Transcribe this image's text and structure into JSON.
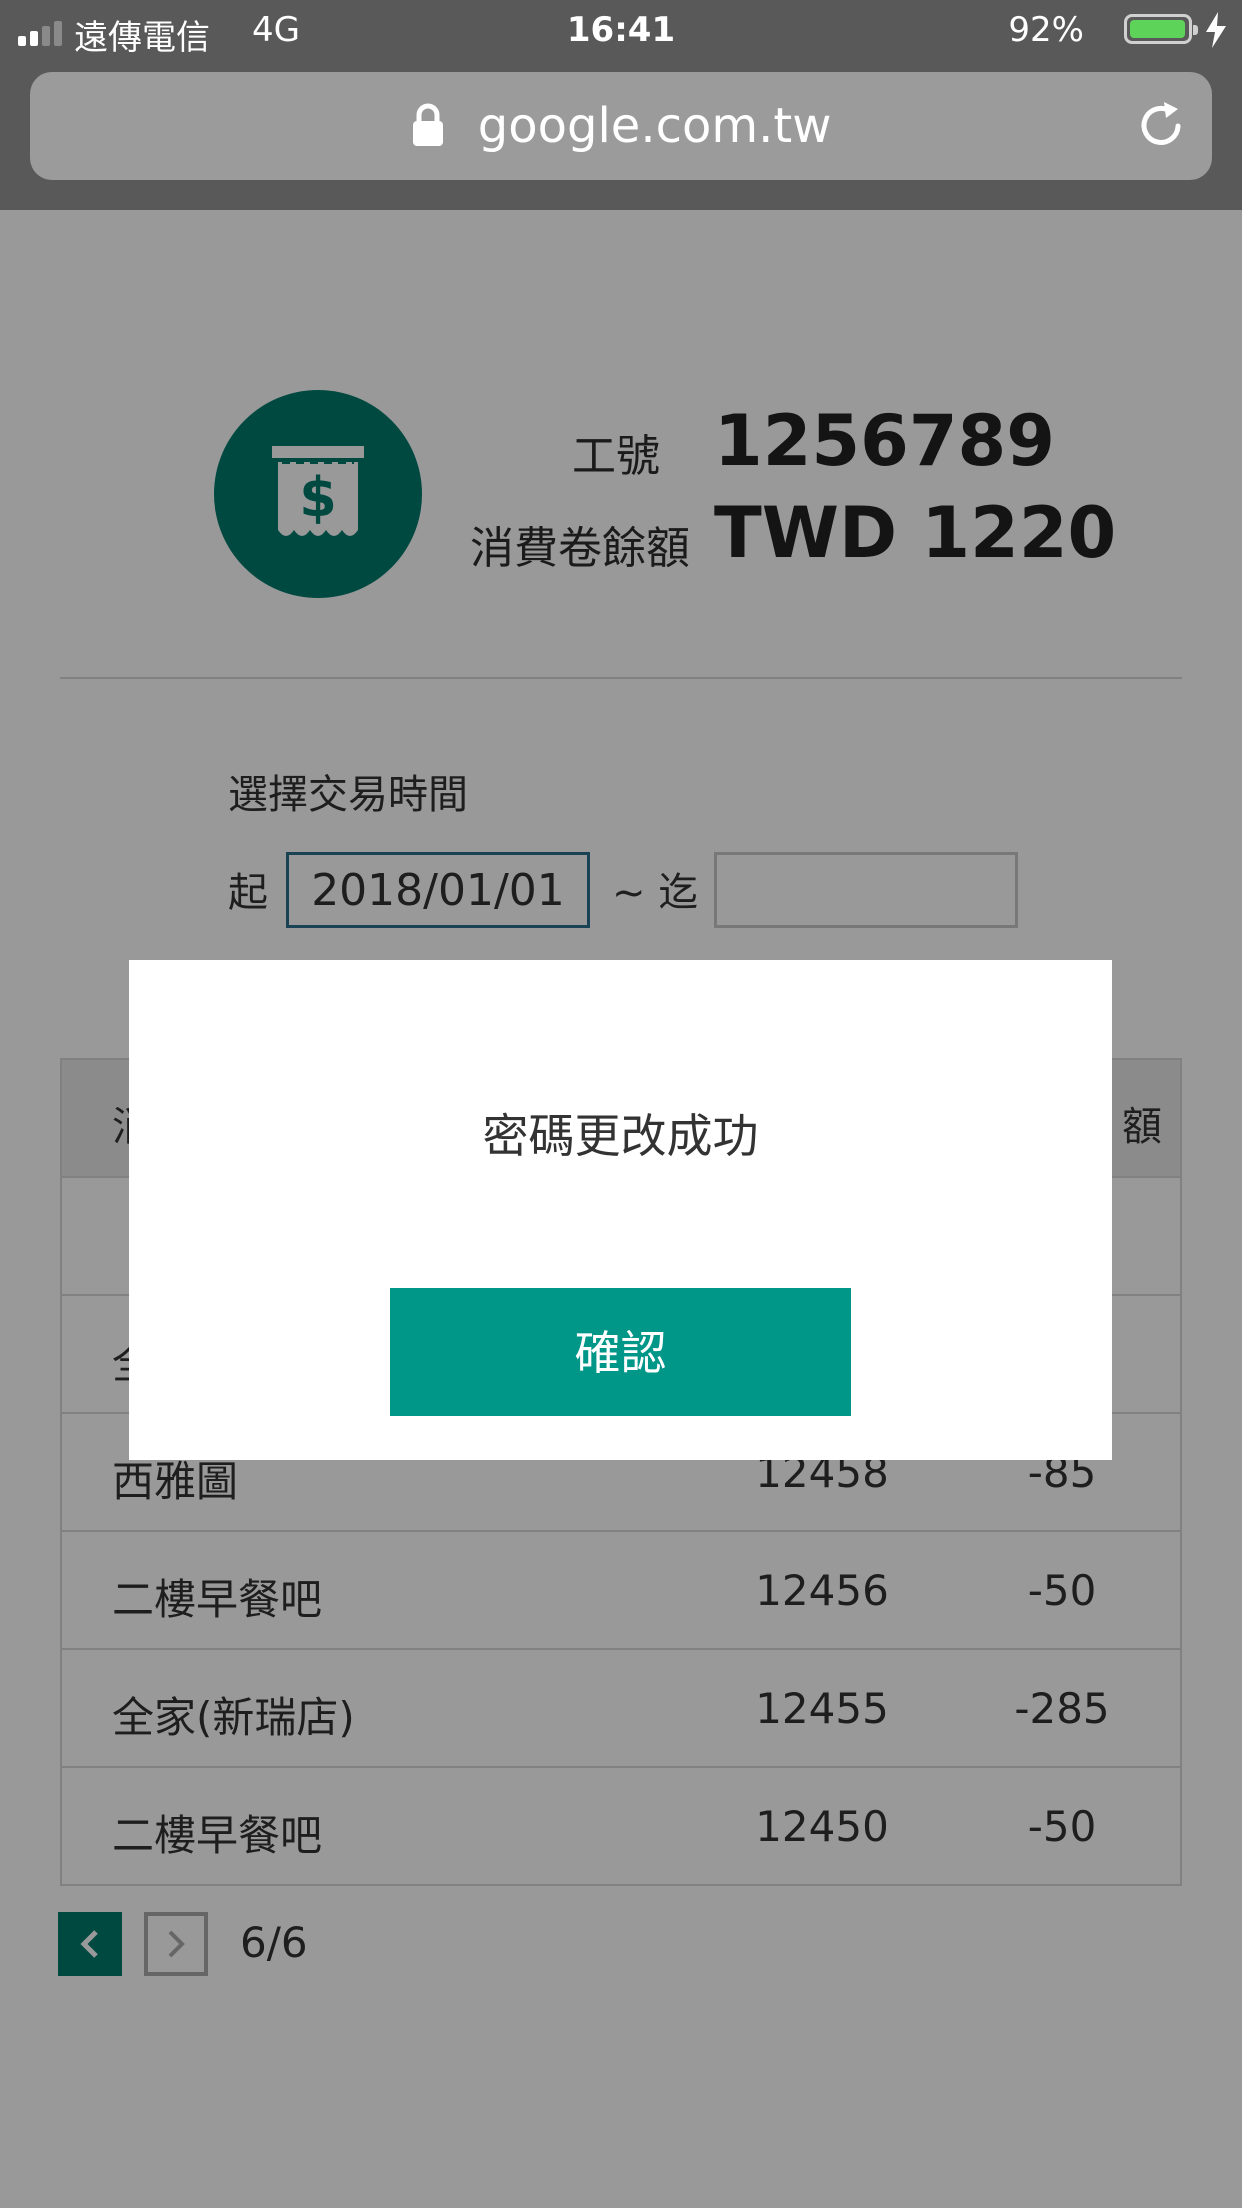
{
  "status_bar": {
    "carrier": "遠傳電信",
    "network": "4G",
    "time": "16:41",
    "battery_percent": "92%",
    "battery_level": 0.92
  },
  "browser": {
    "url": "google.com.tw"
  },
  "profile": {
    "id_label": "工號",
    "id_value": "1256789",
    "balance_label": "消費卷餘額",
    "balance_value": "TWD 1220"
  },
  "filter": {
    "title": "選擇交易時間",
    "from_label": "起",
    "from_value": "2018/01/01",
    "to_label": "~ 迄",
    "to_value": ""
  },
  "table": {
    "header": {
      "col1": "消",
      "col3": "額"
    },
    "rows": [
      {
        "name": "",
        "number": "",
        "amount": ""
      },
      {
        "name": "全",
        "number": "",
        "amount": ""
      },
      {
        "name": "西雅圖",
        "number": "12458",
        "amount": "-85"
      },
      {
        "name": "二樓早餐吧",
        "number": "12456",
        "amount": "-50"
      },
      {
        "name": "全家(新瑞店)",
        "number": "12455",
        "amount": "-285"
      },
      {
        "name": "二樓早餐吧",
        "number": "12450",
        "amount": "-50"
      }
    ]
  },
  "pager": {
    "text": "6/6"
  },
  "dialog": {
    "message": "密碼更改成功",
    "confirm_label": "確認"
  },
  "colors": {
    "brand_teal": "#007a6c",
    "button_teal": "#009688"
  },
  "icons": {
    "avatar": "receipt-dollar-icon",
    "lock": "lock-icon",
    "reload": "reload-icon",
    "prev": "chevron-left-icon",
    "next": "chevron-right-icon"
  }
}
